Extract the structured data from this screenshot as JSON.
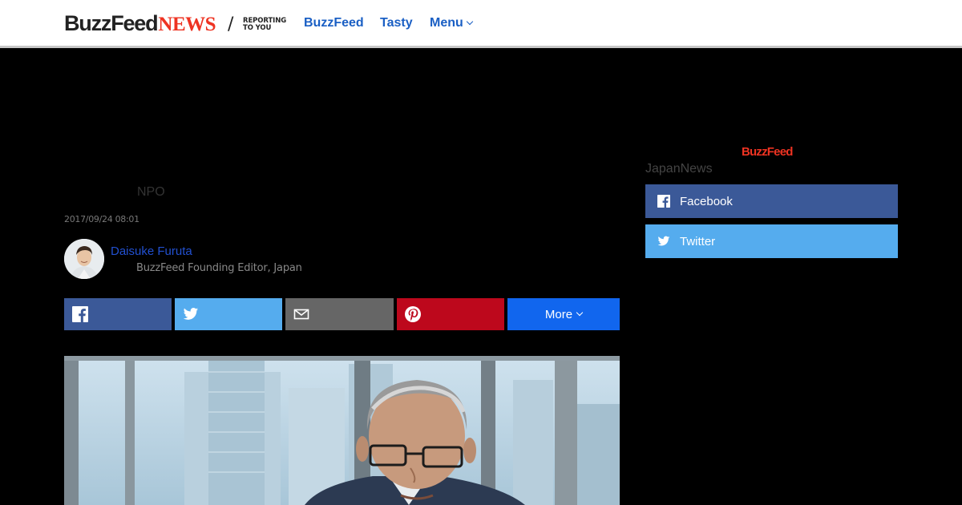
{
  "header": {
    "logo_buzzfeed": "BuzzFeed",
    "logo_news": "NEWS",
    "slash": "/",
    "tagline_line1": "REPORTING",
    "tagline_line2": "TO YOU",
    "nav": {
      "buzzfeed": "BuzzFeed",
      "tasty": "Tasty",
      "menu": "Menu"
    }
  },
  "article": {
    "title_fragment": "NPO",
    "date": "2017/09/24 08:01",
    "author": {
      "name": "Daisuke Furuta",
      "role": "BuzzFeed Founding Editor, Japan"
    }
  },
  "share": {
    "more_label": "More",
    "icons": [
      "facebook-icon",
      "twitter-icon",
      "email-icon",
      "pinterest-icon"
    ]
  },
  "sidebar": {
    "logo": "BuzzFeed",
    "title": "JapanNews",
    "facebook_label": "Facebook",
    "twitter_label": "Twitter"
  },
  "colors": {
    "nav_link": "#1a5fc4",
    "news_red": "#e32",
    "facebook": "#3b5998",
    "twitter": "#55acee",
    "email": "#666666",
    "pinterest": "#bd081c",
    "more": "#1166ee"
  }
}
